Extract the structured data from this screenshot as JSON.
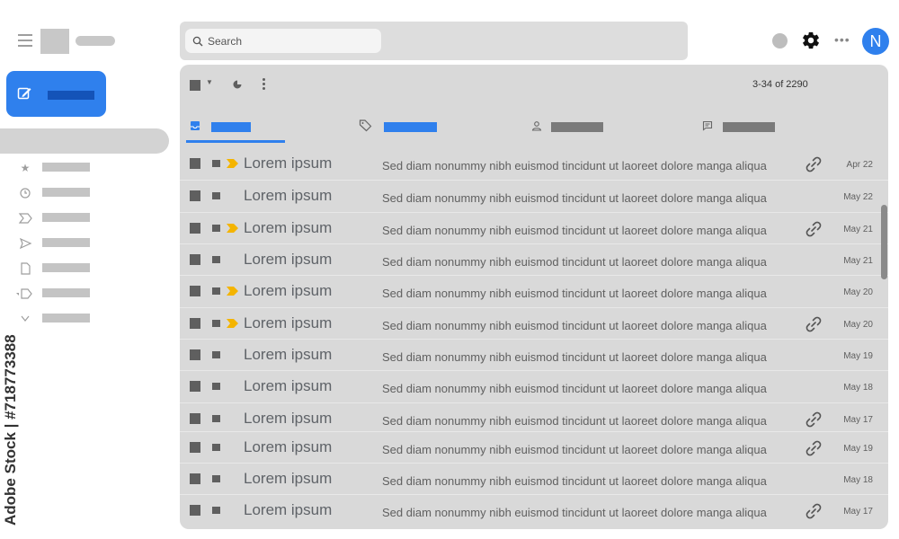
{
  "sidebar": {
    "compose_icon": "pencil-icon",
    "nav_icons": [
      "star-icon",
      "clock-icon",
      "important-icon",
      "send-icon",
      "file-icon",
      "label-icon",
      "chevron-down-icon"
    ]
  },
  "header": {
    "search_placeholder": "Search",
    "avatar_initial": "N"
  },
  "toolbar": {
    "page_count": "3-34 of 2290"
  },
  "tabs": [
    {
      "icon": "inbox-icon",
      "color": "#2f80ed",
      "active": true
    },
    {
      "icon": "tag-icon",
      "color": "#2f80ed",
      "active": false
    },
    {
      "icon": "person-icon",
      "color": "#7a7a7a",
      "active": false
    },
    {
      "icon": "chat-icon",
      "color": "#7a7a7a",
      "active": false
    }
  ],
  "emails": [
    {
      "sender": "Lorem ipsum",
      "snippet": "Sed diam nonummy nibh euismod tincidunt ut laoreet dolore manga aliqua",
      "date": "Apr 22",
      "important": true,
      "attachment": true
    },
    {
      "sender": "Lorem ipsum",
      "snippet": "Sed diam nonummy nibh euismod tincidunt ut laoreet dolore manga aliqua",
      "date": "May 22",
      "important": false,
      "attachment": false
    },
    {
      "sender": "Lorem ipsum",
      "snippet": "Sed diam nonummy nibh euismod tincidunt ut laoreet dolore manga aliqua",
      "date": "May 21",
      "important": true,
      "attachment": true
    },
    {
      "sender": "Lorem ipsum",
      "snippet": "Sed diam nonummy nibh euismod tincidunt ut laoreet dolore manga aliqua",
      "date": "May 21",
      "important": false,
      "attachment": false
    },
    {
      "sender": "Lorem ipsum",
      "snippet": "Sed diam nonummy nibh euismod tincidunt ut laoreet dolore manga aliqua",
      "date": "May 20",
      "important": true,
      "attachment": false
    },
    {
      "sender": "Lorem ipsum",
      "snippet": "Sed diam nonummy nibh euismod tincidunt ut laoreet dolore manga aliqua",
      "date": "May 20",
      "important": true,
      "attachment": true
    },
    {
      "sender": "Lorem ipsum",
      "snippet": "Sed diam nonummy nibh euismod tincidunt ut laoreet dolore manga aliqua",
      "date": "May 19",
      "important": false,
      "attachment": false
    },
    {
      "sender": "Lorem ipsum",
      "snippet": "Sed diam nonummy nibh euismod tincidunt ut laoreet dolore manga aliqua",
      "date": "May 18",
      "important": false,
      "attachment": false
    },
    {
      "sender": "Lorem ipsum",
      "snippet": "Sed diam nonummy nibh euismod tincidunt ut laoreet dolore manga aliqua",
      "date": "May 17",
      "important": false,
      "attachment": true
    },
    {
      "sender": "Lorem ipsum",
      "snippet": "Sed diam nonummy nibh euismod tincidunt ut laoreet dolore manga aliqua",
      "date": "May 19",
      "important": false,
      "attachment": true
    },
    {
      "sender": "Lorem ipsum",
      "snippet": "Sed diam nonummy nibh euismod tincidunt ut laoreet dolore manga aliqua",
      "date": "May 18",
      "important": false,
      "attachment": false
    },
    {
      "sender": "Lorem ipsum",
      "snippet": "Sed diam nonummy nibh euismod tincidunt ut laoreet dolore manga aliqua",
      "date": "May 17",
      "important": false,
      "attachment": true
    }
  ],
  "watermark": {
    "side_text": "Adobe Stock | #718773388"
  },
  "colors": {
    "accent": "#2f80ed",
    "important_marker": "#f4b400"
  }
}
